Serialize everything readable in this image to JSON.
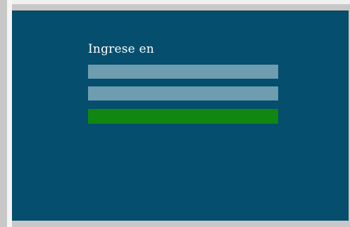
{
  "login": {
    "title": "Ingrese en",
    "username_value": "",
    "password_value": "",
    "submit_label": ""
  },
  "colors": {
    "panel_bg": "#054e6e",
    "field_bg": "#6e9db0",
    "submit_bg": "#118611"
  }
}
